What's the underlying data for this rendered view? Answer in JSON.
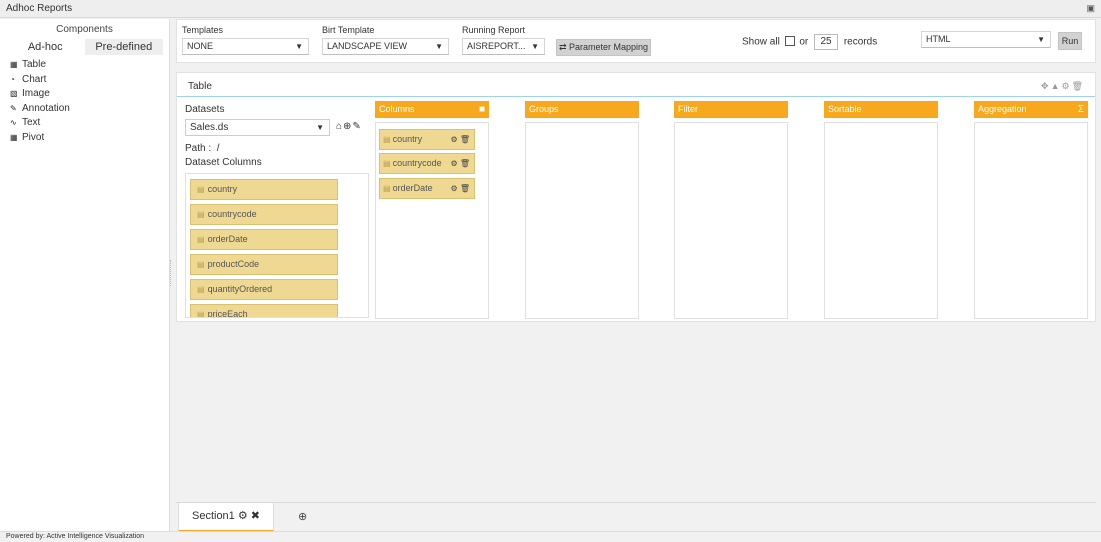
{
  "app": {
    "title": "Adhoc Reports",
    "save_icon": "floppy-disk"
  },
  "sidebar": {
    "heading": "Components",
    "tabs": [
      {
        "label": "Ad-hoc"
      },
      {
        "label": "Pre-defined"
      }
    ],
    "items": [
      {
        "label": "Table",
        "icon": "table-grid"
      },
      {
        "label": "Chart",
        "icon": "pie-chart"
      },
      {
        "label": "Image",
        "icon": "picture"
      },
      {
        "label": "Annotation",
        "icon": "pencil"
      },
      {
        "label": "Text",
        "icon": "text-wave"
      },
      {
        "label": "Pivot",
        "icon": "pivot-grid"
      }
    ]
  },
  "toolbar": {
    "templates_label": "Templates",
    "templates_value": "NONE",
    "birt_label": "Birt Template",
    "birt_value": "LANDSCAPE VIEW",
    "running_label": "Running Report",
    "running_value": "AISREPORT...",
    "param_button": "Parameter Mapping",
    "show_all": "Show all",
    "or": "or",
    "records_value": "25",
    "records_label": "records",
    "format_value": "HTML",
    "run_button": "Run"
  },
  "table_panel": {
    "title": "Table",
    "datasets_label": "Datasets",
    "dataset_value": "Sales.ds",
    "path_label": "Path :",
    "path_value": "/",
    "dataset_columns_label": "Dataset Columns",
    "dataset_columns": [
      "country",
      "countrycode",
      "orderDate",
      "productCode",
      "quantityOrdered",
      "priceEach"
    ],
    "columns_header": "Columns",
    "columns": [
      "country",
      "countrycode",
      "orderDate"
    ],
    "groups_header": "Groups",
    "filter_header": "Filter",
    "sortable_header": "Sortable",
    "aggregation_header": "Aggregation",
    "aggregation_icon": "Σ"
  },
  "sections": {
    "tab_label": "Section1"
  },
  "footer": {
    "powered_by": "Powered by: Active Intelligence Visualization"
  },
  "colors": {
    "orange": "#f7a81c",
    "item": "#efd992",
    "accent_line": "#9fd3e8"
  }
}
